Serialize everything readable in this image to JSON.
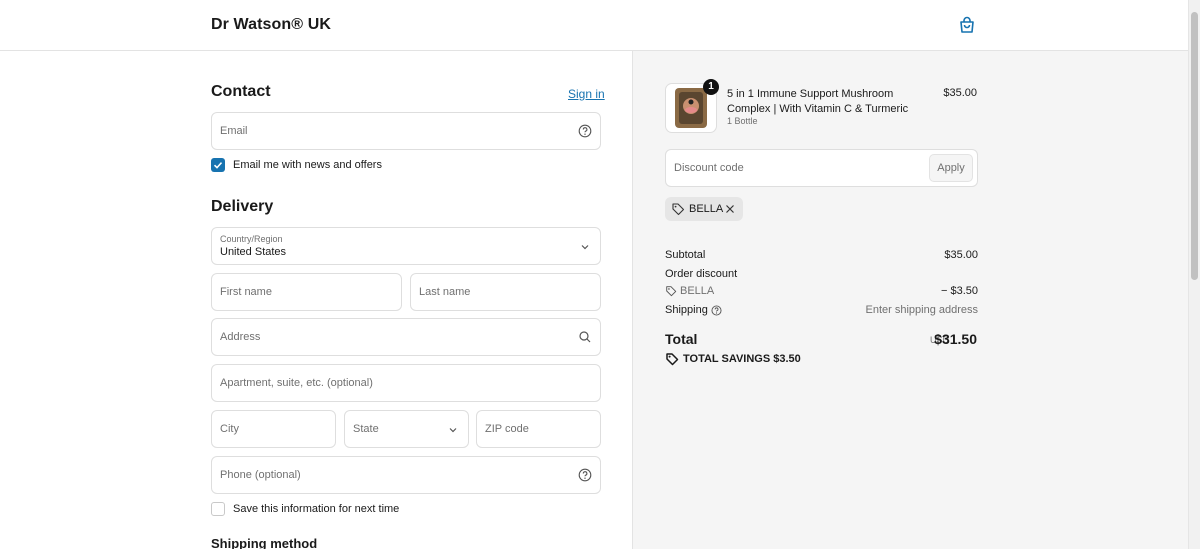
{
  "header": {
    "brand": "Dr Watson® UK",
    "bag_icon": "shopping-bag-icon"
  },
  "contact": {
    "title": "Contact",
    "sign_in": "Sign in",
    "email_placeholder": "Email",
    "email_news_label": "Email me with news and offers",
    "email_news_checked": true
  },
  "delivery": {
    "title": "Delivery",
    "country_label": "Country/Region",
    "country_value": "United States",
    "first_name": "First name",
    "last_name": "Last name",
    "address": "Address",
    "apartment": "Apartment, suite, etc. (optional)",
    "city": "City",
    "state": "State",
    "zip": "ZIP code",
    "phone": "Phone (optional)",
    "save_info_label": "Save this information for next time",
    "save_info_checked": false
  },
  "shipping_method": {
    "title": "Shipping method"
  },
  "summary": {
    "item": {
      "quantity": "1",
      "name": "5 in 1 Immune Support Mushroom Complex | With Vitamin C & Turmeric",
      "variant": "1 Bottle",
      "price": "$35.00"
    },
    "discount_placeholder": "Discount code",
    "apply_label": "Apply",
    "applied_code": "BELLA",
    "subtotal_label": "Subtotal",
    "subtotal_value": "$35.00",
    "order_discount_label": "Order discount",
    "discount_code": "BELLA",
    "discount_value": "− $3.50",
    "shipping_label": "Shipping",
    "shipping_value": "Enter shipping address",
    "total_label": "Total",
    "currency": "USD",
    "total_value": "$31.50",
    "savings_label": "TOTAL SAVINGS",
    "savings_value": "$3.50"
  },
  "colors": {
    "accent": "#1773b0",
    "panel": "#f5f5f5",
    "border": "#dedede"
  }
}
